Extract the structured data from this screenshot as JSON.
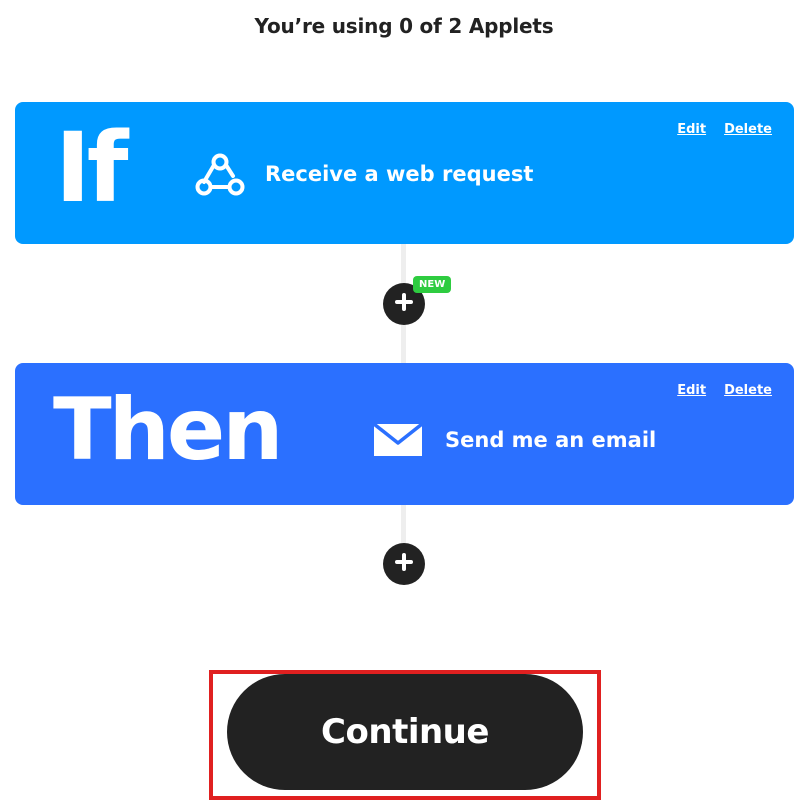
{
  "header": {
    "usage_text": "You’re using 0 of 2 Applets"
  },
  "trigger": {
    "keyword": "If",
    "service_icon": "webhooks-icon",
    "label": "Receive a web request",
    "edit_label": "Edit",
    "delete_label": "Delete",
    "color": "#0099ff"
  },
  "add_step_after_trigger": {
    "badge": "NEW"
  },
  "action": {
    "keyword": "Then",
    "service_icon": "email-icon",
    "label": "Send me an email",
    "edit_label": "Edit",
    "delete_label": "Delete",
    "color": "#2b70ff"
  },
  "footer": {
    "continue_label": "Continue"
  },
  "colors": {
    "dark": "#222222",
    "badge": "#2ecc40",
    "highlight": "#e02020"
  }
}
